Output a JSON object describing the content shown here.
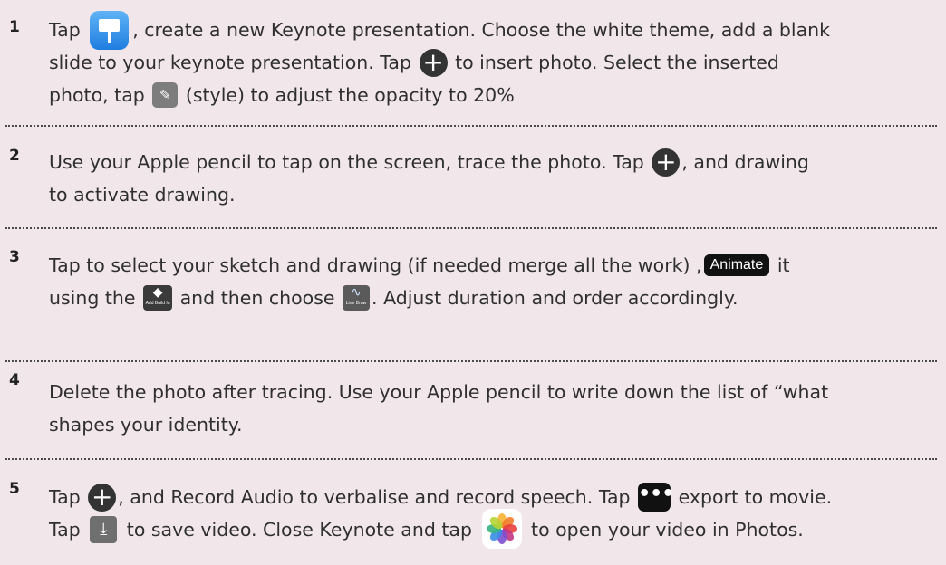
{
  "steps": [
    {
      "number": "1",
      "l1a": "Tap",
      "l1b": ", create a new Keynote presentation. Choose the white theme, add a blank",
      "l2a": "slide to your keynote presentation. Tap",
      "l2b": "to insert photo. Select the inserted",
      "l3a": "photo, tap",
      "l3b": "(style) to adjust the opacity to 20%"
    },
    {
      "number": "2",
      "l1a": "Use your Apple pencil to tap on the screen, trace the photo.  Tap",
      "l1b": ", and drawing",
      "l2a": "to activate drawing."
    },
    {
      "number": "3",
      "l1a": "Tap to select your sketch and drawing (if needed merge all the work)",
      "l1b": ",",
      "animate_label": "Animate",
      "l1c": "it",
      "l2a": "using the",
      "add_build_label": "Add Build In",
      "l2b": "and then choose",
      "line_draw_label": "Line Draw",
      "l2c": ". Adjust duration and order accordingly."
    },
    {
      "number": "4",
      "l1a": "Delete the photo after tracing. Use your Apple pencil to write down the list of “what",
      "l2a": "shapes your identity."
    },
    {
      "number": "5",
      "l1a": "Tap",
      "l1b": ", and Record Audio to verbalise and record speech. Tap",
      "l1c": "export to movie.",
      "l2a": "Tap",
      "l2b": "to save video. Close Keynote and tap",
      "l2c": "to open your video in Photos."
    }
  ],
  "icons": {
    "keynote": "keynote-app-icon",
    "plus": "plus-icon",
    "style": "paintbrush-icon",
    "add_build": "add-build-in-icon",
    "line_draw": "line-draw-icon",
    "more": "more-icon",
    "save": "save-download-icon",
    "photos": "photos-app-icon"
  }
}
